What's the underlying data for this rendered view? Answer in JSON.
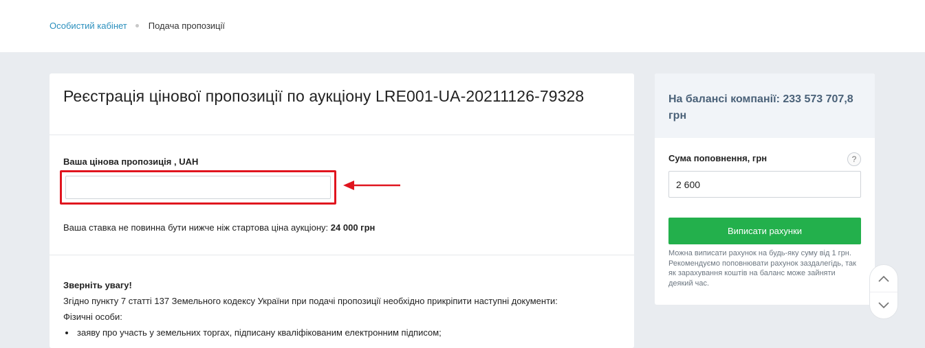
{
  "breadcrumb": {
    "home": "Особистий кабінет",
    "current": "Подача пропозиції"
  },
  "main": {
    "title": "Реєстрація цінової пропозиції по аукціону LRE001-UA-20211126-79328",
    "bid_label": "Ваша цінова пропозиція , UAH",
    "bid_value": "",
    "min_note_prefix": "Ваша ставка не повинна бути нижче ніж стартова ціна аукціону: ",
    "min_note_amount": "24 000 грн",
    "notice": {
      "title": "Зверніть увагу!",
      "line1": "Згідно пункту 7 статті 137 Земельного кодексу України при подачі пропозиції необхідно прикріпити наступні документи:",
      "line2": "Фізичні особи:",
      "items": [
        "заяву про участь у земельних торгах, підписану кваліфікованим електронним підписом;"
      ]
    }
  },
  "sidebar": {
    "balance": "На балансі компанії: 233 573 707,8 грн",
    "topup_label": "Сума поповнення, грн",
    "help_icon": "?",
    "topup_value": "2 600",
    "invoice_button": "Виписати рахунки",
    "invoice_note": "Можна виписати рахунок на будь-яку суму від 1 грн. Рекомендуємо поповнювати рахунок заздалегідь, так як зарахування коштів на баланс може зайняти деякий час."
  },
  "colors": {
    "link": "#2a8fbd",
    "accent_green": "#23b04c",
    "highlight_red": "#e0141e",
    "balance_text": "#4a6178"
  },
  "icons": [
    "arrow-left-icon",
    "question-icon",
    "chevron-up-icon",
    "chevron-down-icon"
  ]
}
